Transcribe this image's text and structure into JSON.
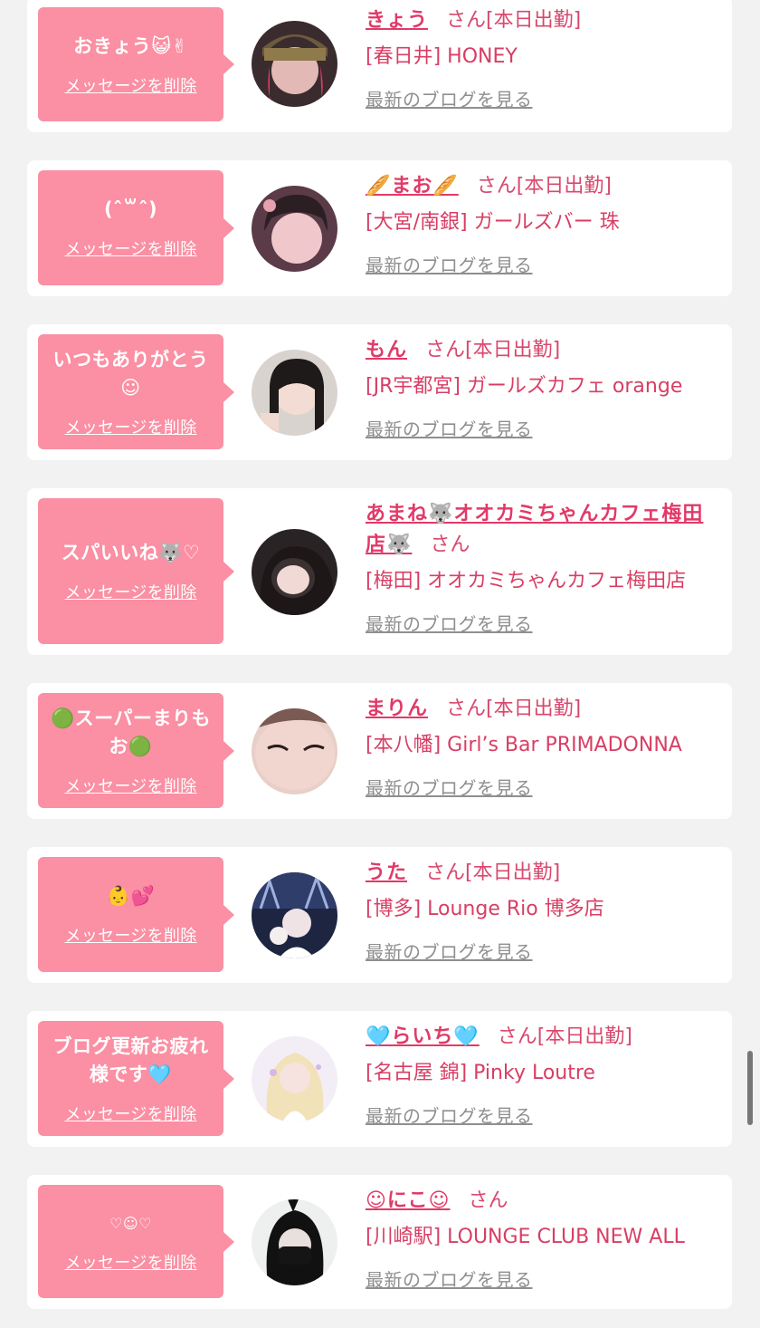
{
  "colors": {
    "background": "#f2f2f2",
    "card": "#ffffff",
    "bubble": "#fb8fa3",
    "name": "#e13a68",
    "text": "#d83e64",
    "link_gray": "#8f8f8f"
  },
  "delete_label": "メッセージを削除",
  "blog_label": "最新のブログを見る",
  "cards": [
    {
      "message": "おきょう😺✌",
      "name": "きょう",
      "san": "さん[本日出勤]",
      "shop": "[春日井] HONEY",
      "avatar_icon": "avatar-photo"
    },
    {
      "message": "(ˆ꒳ˆ)",
      "name": "🥖まお🥖",
      "san": "さん[本日出勤]",
      "shop": "[大宮/南銀] ガールズバー 珠",
      "avatar_icon": "avatar-photo"
    },
    {
      "message": "いつもありがとう☺",
      "name": "もん",
      "san": "さん[本日出勤]",
      "shop": "[JR宇都宮] ガールズカフェ orange",
      "avatar_icon": "avatar-photo"
    },
    {
      "message": "スパいいね🐺♡",
      "name": "あまね🐺オオカミちゃんカフェ梅田店🐺",
      "san": "さん",
      "shop": "[梅田] オオカミちゃんカフェ梅田店",
      "avatar_icon": "avatar-photo"
    },
    {
      "message": "🟢スーパーまりもお🟢",
      "name": "まりん",
      "san": "さん[本日出勤]",
      "shop": "[本八幡] Girl’s Bar PRIMADONNA",
      "avatar_icon": "avatar-photo"
    },
    {
      "message": "👶💕",
      "name": "うた",
      "san": "さん[本日出勤]",
      "shop": "[博多] Lounge Rio 博多店",
      "avatar_icon": "avatar-photo"
    },
    {
      "message": "ブログ更新お疲れ様です🩵",
      "name": "🩵らいち🩵",
      "san": "さん[本日出勤]",
      "shop": "[名古屋 錦] Pinky Loutre",
      "avatar_icon": "avatar-photo"
    },
    {
      "message": "♡☺♡",
      "name": "☺にこ☺",
      "san": "さん",
      "shop": "[川崎駅] LOUNGE CLUB NEW ALL",
      "avatar_icon": "avatar-photo"
    }
  ]
}
